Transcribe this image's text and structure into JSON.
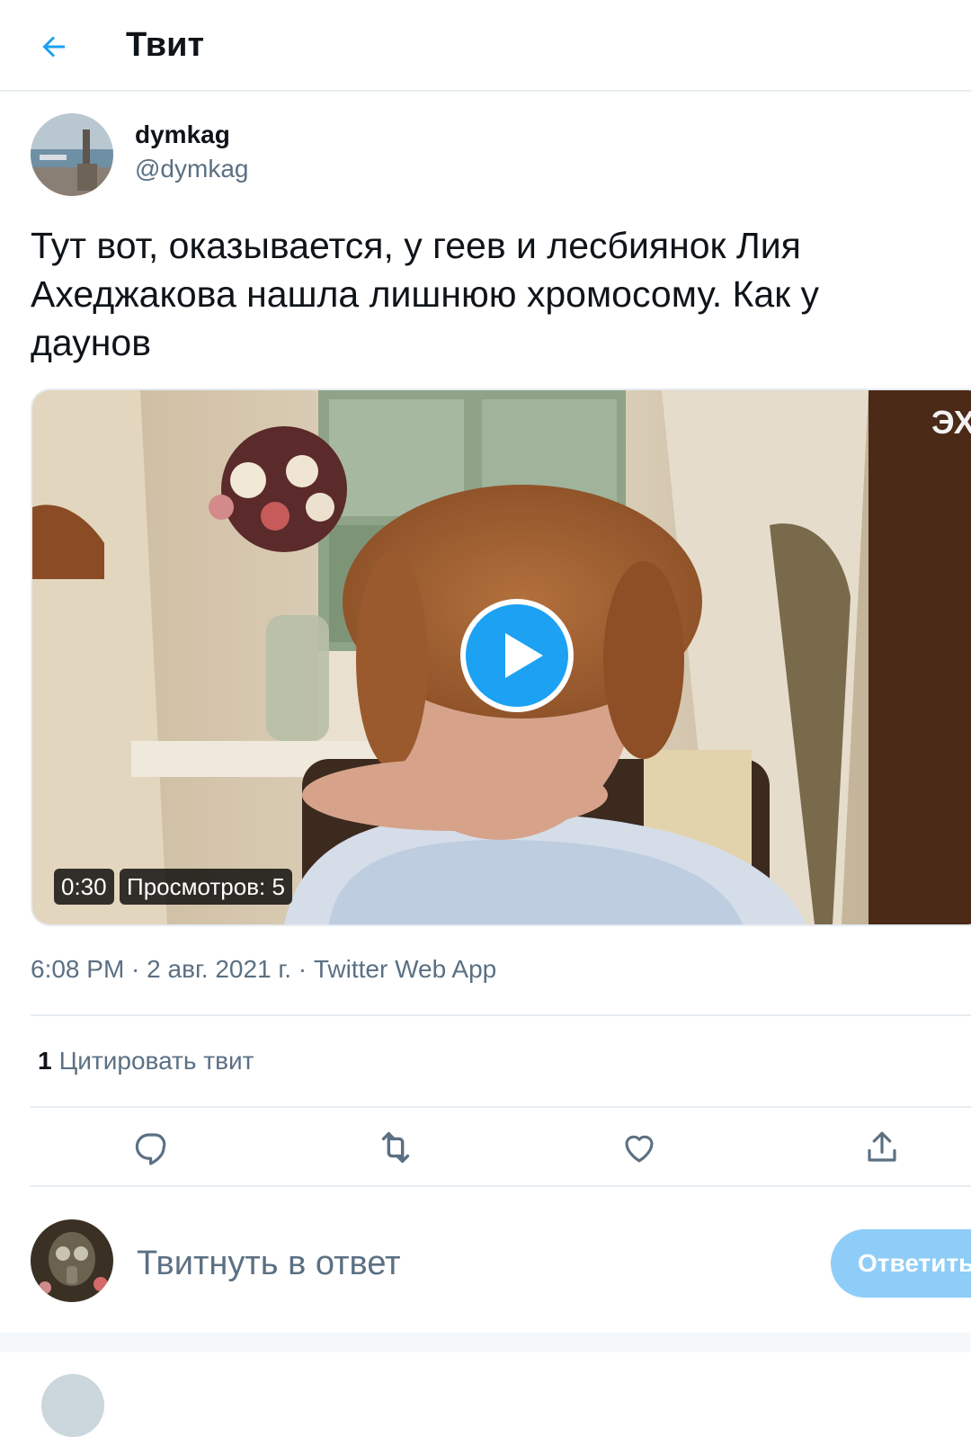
{
  "header": {
    "title": "Твит",
    "back_icon": "arrow-left-icon"
  },
  "author": {
    "display_name": "dymkag",
    "handle": "@dymkag"
  },
  "tweet": {
    "text": "Тут вот, оказывается, у геев и лесбиянок Лия Ахеджакова нашла лишнюю хромосому. Как у даунов"
  },
  "media": {
    "duration": "0:30",
    "views": "Просмотров: 5",
    "channel_logo": "ЭХО",
    "play_icon": "play-icon"
  },
  "meta": {
    "time": "6:08 PM",
    "separator": " · ",
    "date": "2 авг. 2021 г.",
    "source": "Twitter Web App"
  },
  "stats": {
    "quote_count": "1",
    "quote_label": "Цитировать твит"
  },
  "actions": [
    "reply-icon",
    "retweet-icon",
    "like-icon",
    "share-icon"
  ],
  "reply": {
    "placeholder": "Твитнуть в ответ",
    "button_label": "Ответить"
  },
  "colors": {
    "accent": "#1da1f2",
    "accent_disabled": "#8ecdf8",
    "secondary_text": "#5b7083",
    "divider": "#e6ecf0"
  }
}
